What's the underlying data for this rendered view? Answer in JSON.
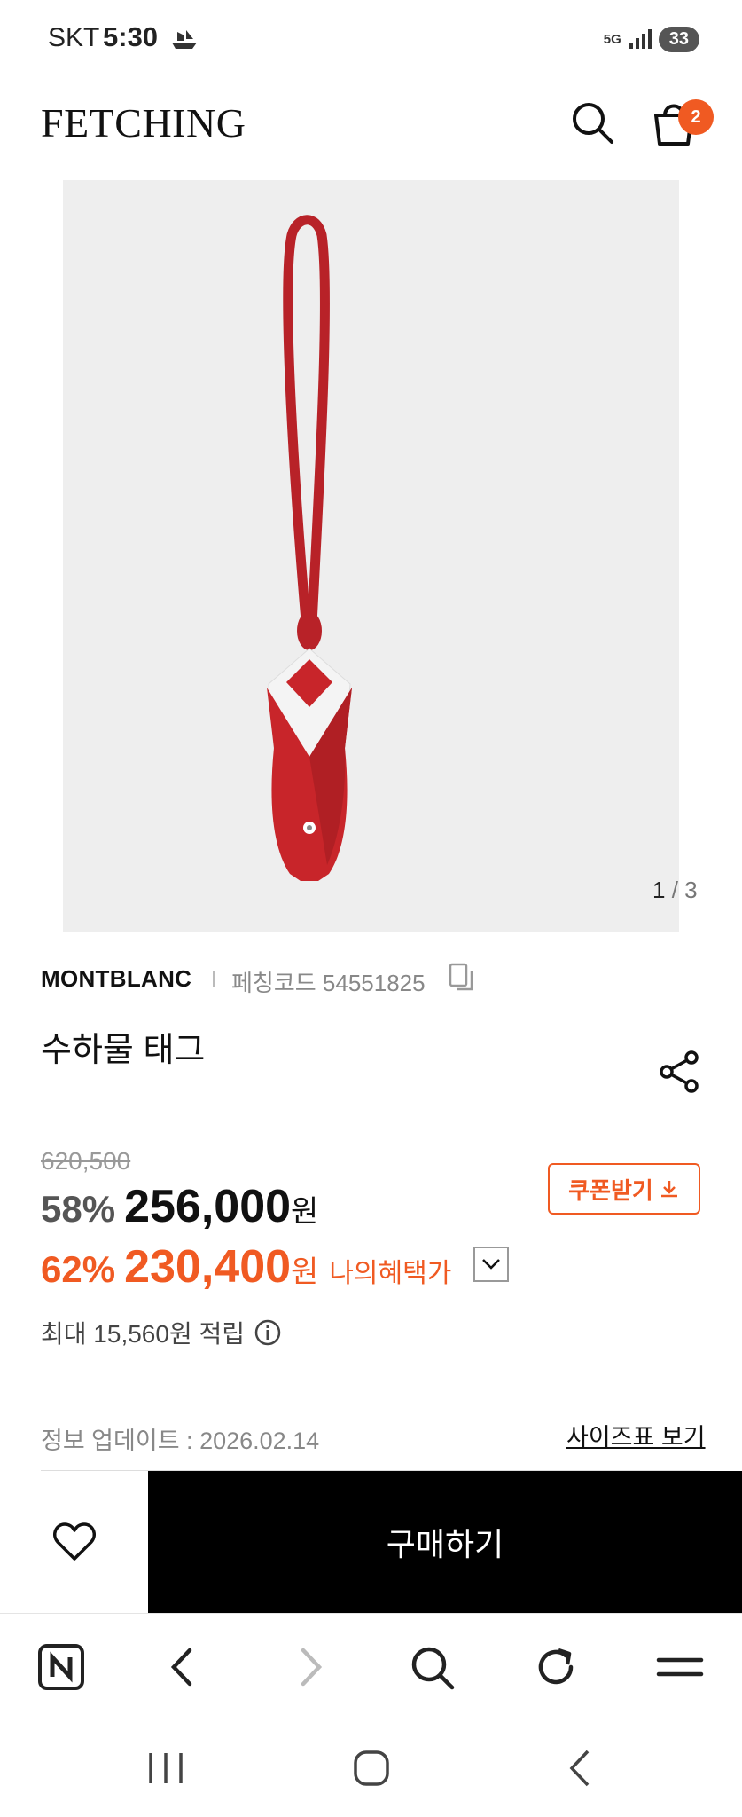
{
  "status_bar": {
    "carrier": "SKT",
    "time": "5:30",
    "network": "5G",
    "battery": "33"
  },
  "header": {
    "logo": "FETCHING",
    "cart_count": "2"
  },
  "image": {
    "current": "1",
    "total": "3",
    "counter_separator": "/"
  },
  "product": {
    "brand": "MONTBLANC",
    "fetching_code_label": "페칭코드",
    "fetching_code": "54551825",
    "name": "수하물 태그"
  },
  "pricing": {
    "original_price": "620,500",
    "discount_rate": "58%",
    "sale_price": "256,000",
    "currency": "원",
    "benefit_rate": "62%",
    "benefit_price": "230,400",
    "benefit_label": "나의혜택가",
    "coupon_label": "쿠폰받기",
    "points_text": "최대 15,560원 적립"
  },
  "info": {
    "update_label": "정보 업데이트 :",
    "update_date": "2026.02.14",
    "size_chart_label": "사이즈표 보기"
  },
  "actions": {
    "buy_label": "구매하기"
  },
  "colors": {
    "accent": "#f05a22",
    "buy_bg": "#000000",
    "image_bg": "#eeeeee",
    "product_red": "#c8252a"
  },
  "icons": {
    "header": [
      "search-icon",
      "cart-icon"
    ],
    "toolbar": [
      "naver-home-icon",
      "back-icon",
      "forward-icon",
      "search-icon",
      "refresh-icon",
      "menu-icon"
    ],
    "system": [
      "recents-icon",
      "home-icon",
      "back-icon"
    ]
  }
}
